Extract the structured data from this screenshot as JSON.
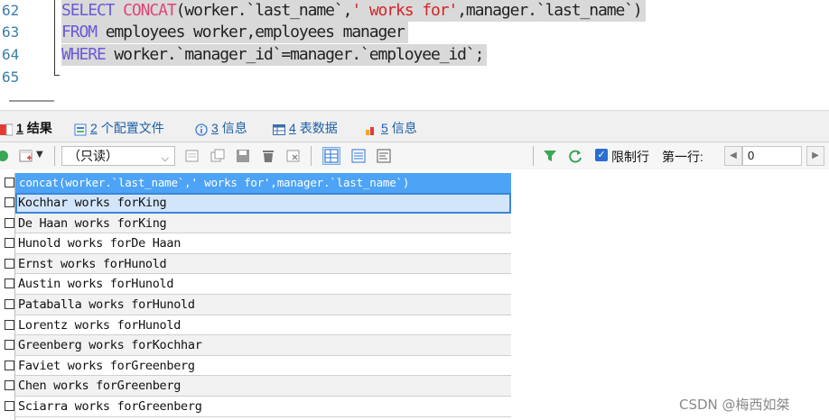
{
  "editor": {
    "line_numbers": [
      "62",
      "63",
      "64",
      "65"
    ],
    "lines": [
      {
        "kw1": "SELECT",
        "fn": "CONCAT",
        "part1": "(worker.`last_name`,",
        "str": "' works for'",
        "part2": ",manager.`last_name`)"
      },
      {
        "kw1": "FROM",
        "rest": " employees worker,employees manager"
      },
      {
        "kw1": "WHERE",
        "rest": " worker.`manager_id`=manager.`employee_id`;"
      }
    ]
  },
  "tabs": [
    {
      "num": "1",
      "label": "结果"
    },
    {
      "num": "2",
      "label": "个配置文件"
    },
    {
      "num": "3",
      "label": "信息"
    },
    {
      "num": "4",
      "label": "表数据"
    },
    {
      "num": "5",
      "label": "信息"
    }
  ],
  "toolbar": {
    "readonly_value": "（只读）",
    "limit_label": "限制行",
    "first_row_label": "第一行:",
    "first_row_value": "0"
  },
  "grid": {
    "column_header": "concat(worker.`last_name`,' works for',manager.`last_name`)",
    "rows": [
      "Kochhar works forKing",
      "De Haan works forKing",
      "Hunold works forDe Haan",
      "Ernst works forHunold",
      "Austin works forHunold",
      "Pataballa works forHunold",
      "Lorentz works forHunold",
      "Greenberg works forKochhar",
      "Faviet works forGreenberg",
      "Chen works forGreenberg",
      "Sciarra works forGreenberg"
    ]
  },
  "watermark": "CSDN @梅西如桀",
  "colors": {
    "keyword": "#6a5ad8",
    "function": "#e0457b",
    "string": "#d4242a",
    "header_blue": "#4da3f5",
    "selection": "#d3e5fb"
  }
}
